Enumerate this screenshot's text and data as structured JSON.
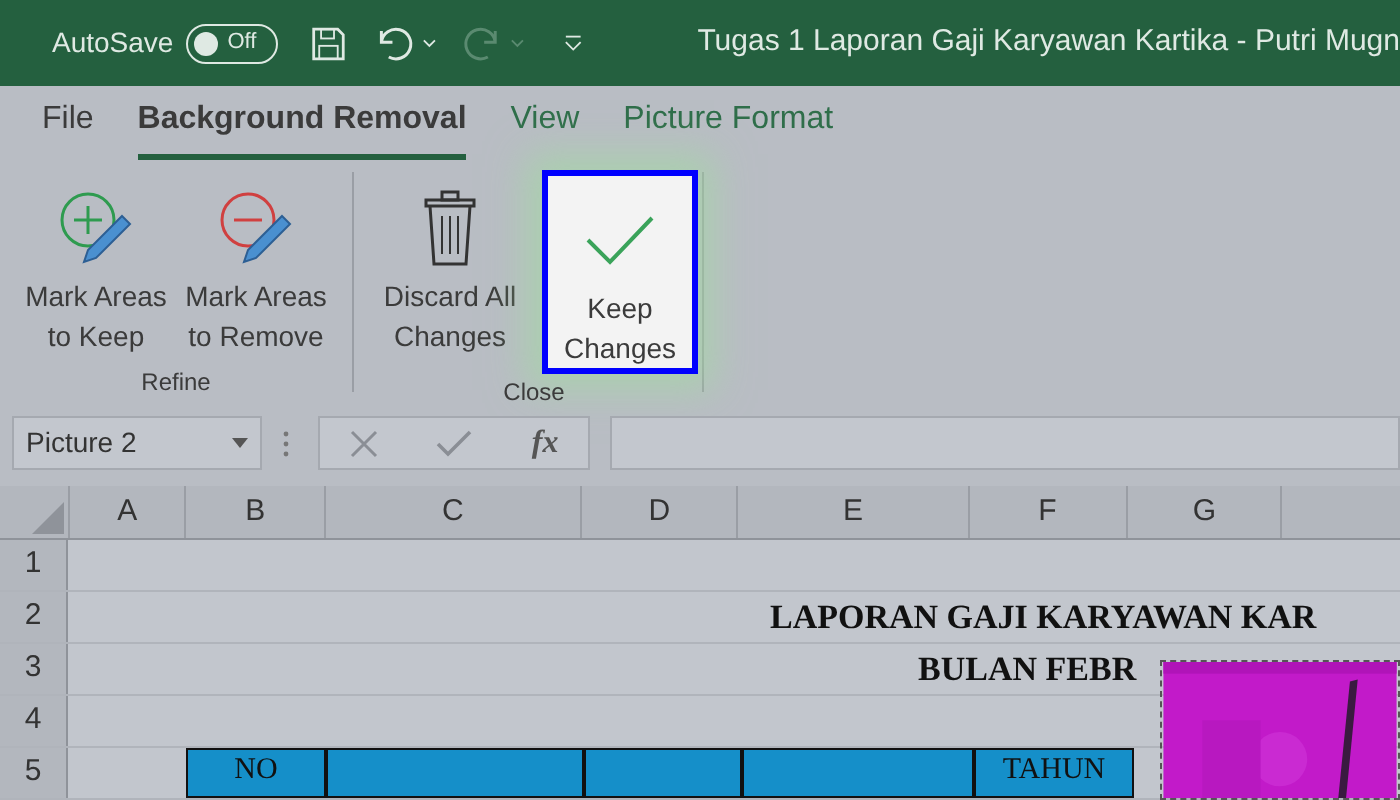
{
  "title_bar": {
    "autosave": {
      "label": "AutoSave",
      "on": false,
      "state_text": "Off"
    },
    "title": "Tugas 1 Laporan Gaji Karyawan Kartika - Putri Mugn"
  },
  "tabs": [
    {
      "label": "File",
      "selected": false,
      "kind": "normal"
    },
    {
      "label": "Background Removal",
      "selected": true,
      "kind": "normal"
    },
    {
      "label": "View",
      "selected": false,
      "kind": "contextual"
    },
    {
      "label": "Picture Format",
      "selected": false,
      "kind": "contextual"
    }
  ],
  "ribbon": {
    "groups": [
      {
        "label": "Refine",
        "buttons": [
          {
            "kind": "mark-keep",
            "lines": [
              "Mark Areas",
              "to Keep"
            ],
            "highlighted": false
          },
          {
            "kind": "mark-remove",
            "lines": [
              "Mark Areas",
              "to Remove"
            ],
            "highlighted": false
          }
        ]
      },
      {
        "label": "Close",
        "buttons": [
          {
            "kind": "discard",
            "lines": [
              "Discard All",
              "Changes"
            ],
            "highlighted": false
          },
          {
            "kind": "keep",
            "lines": [
              "Keep",
              "Changes"
            ],
            "highlighted": true
          }
        ]
      }
    ]
  },
  "formula_bar": {
    "name_box": "Picture 2",
    "function_label": "fx"
  },
  "sheet": {
    "columns": [
      "A",
      "B",
      "C",
      "D",
      "E",
      "F",
      "G"
    ],
    "rows": [
      "1",
      "2",
      "3",
      "4",
      "5"
    ],
    "title": "LAPORAN GAJI KARYAWAN KAR",
    "subtitle": "BULAN FEBR",
    "header_cells": [
      {
        "text": "NO"
      },
      {},
      {},
      {},
      {
        "text": "TAHUN"
      }
    ]
  }
}
